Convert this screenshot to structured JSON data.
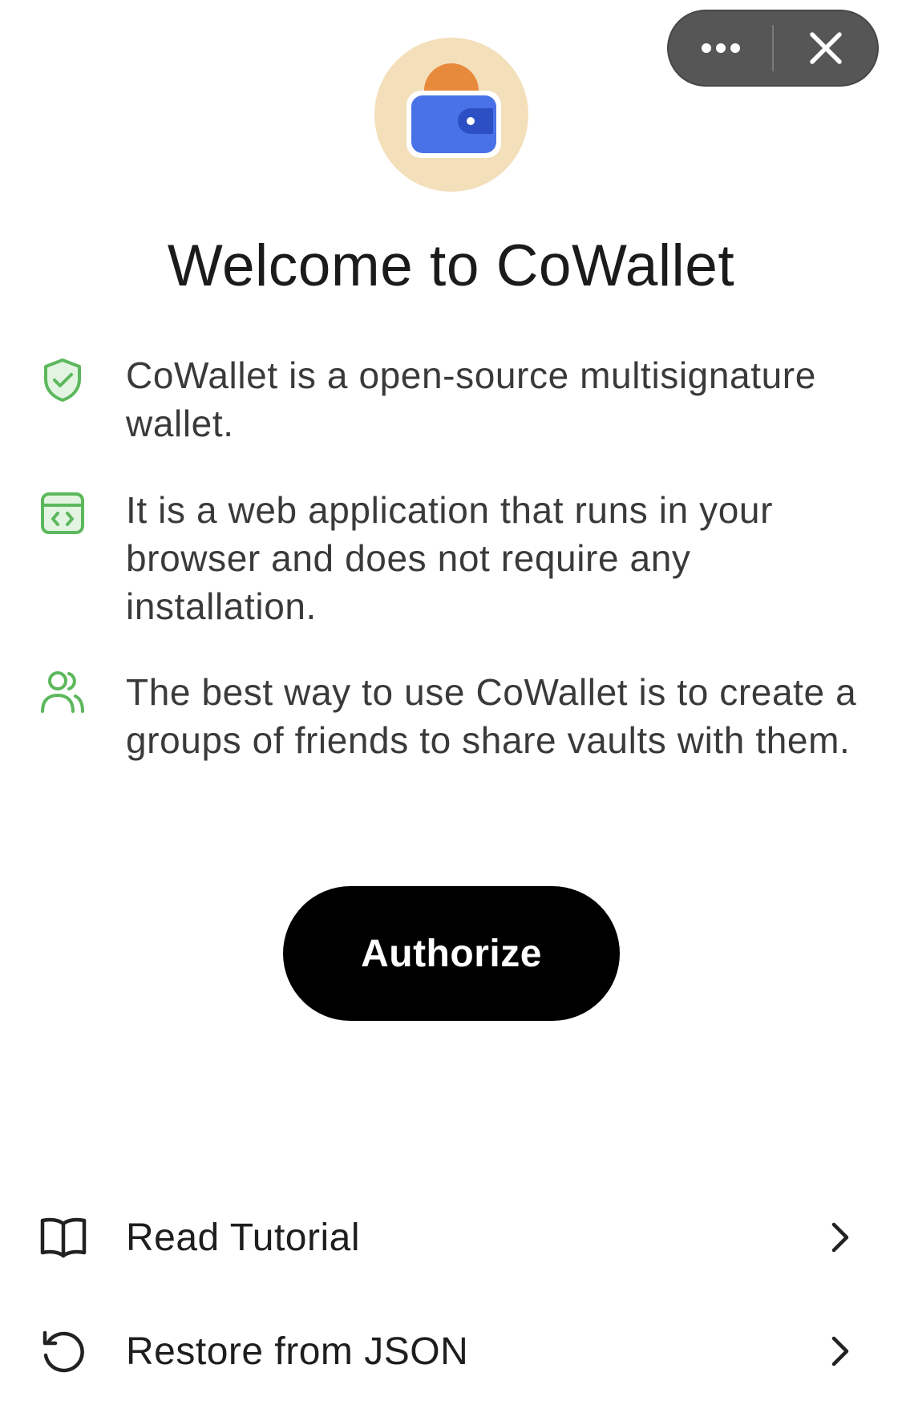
{
  "header": {
    "more_icon": "more-horizontal-icon",
    "close_icon": "close-icon"
  },
  "title": "Welcome to CoWallet",
  "features": [
    {
      "icon": "shield-check-icon",
      "text": "CoWallet is a open-source multisignature wallet."
    },
    {
      "icon": "browser-code-icon",
      "text": "It is a web application that runs in your browser and does not require any installation."
    },
    {
      "icon": "users-icon",
      "text": "The best way to use CoWallet is to create a groups of friends to share vaults with them."
    }
  ],
  "authorize_label": "Authorize",
  "actions": [
    {
      "icon": "book-open-icon",
      "label": "Read Tutorial"
    },
    {
      "icon": "restore-icon",
      "label": "Restore from JSON"
    }
  ],
  "colors": {
    "accent_green": "#5cb85c",
    "button_black": "#000000",
    "capsule_gray": "#565656",
    "logo_bg": "#f4dfbb",
    "wallet_blue": "#4a72e8",
    "coin_orange": "#e88a3c"
  }
}
